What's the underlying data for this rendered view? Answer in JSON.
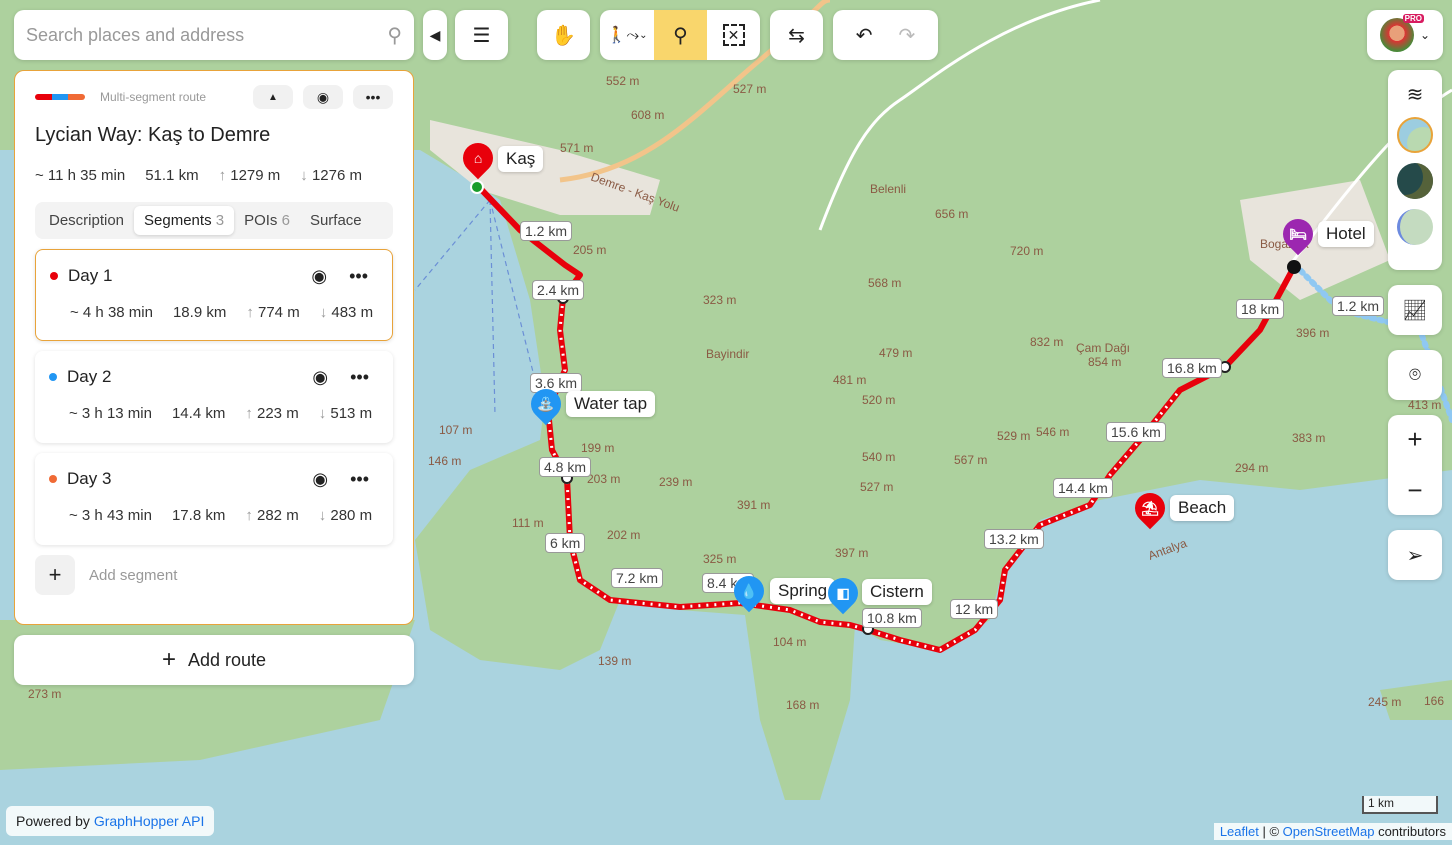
{
  "search": {
    "placeholder": "Search places and address"
  },
  "route": {
    "type_label": "Multi-segment route",
    "title": "Lycian Way: Kaş to Demre",
    "duration": "~ 11 h 35 min",
    "distance": "51.1 km",
    "ascent": "1279 m",
    "descent": "1276 m",
    "colors": [
      "#e8000b",
      "#2196f3",
      "#f06a35"
    ]
  },
  "tabs": [
    {
      "label": "Description",
      "count": ""
    },
    {
      "label": "Segments",
      "count": "3"
    },
    {
      "label": "POIs",
      "count": "6"
    },
    {
      "label": "Surface",
      "count": ""
    }
  ],
  "segments": [
    {
      "name": "Day 1",
      "color": "#e8000b",
      "duration": "~ 4 h 38 min",
      "distance": "18.9 km",
      "ascent": "774 m",
      "descent": "483 m"
    },
    {
      "name": "Day 2",
      "color": "#2196f3",
      "duration": "~ 3 h 13 min",
      "distance": "14.4 km",
      "ascent": "223 m",
      "descent": "513 m"
    },
    {
      "name": "Day 3",
      "color": "#f06a35",
      "duration": "~ 3 h 43 min",
      "distance": "17.8 km",
      "ascent": "282 m",
      "descent": "280 m"
    }
  ],
  "add_segment": "Add segment",
  "add_route": "Add route",
  "profile": {
    "badge": "PRO"
  },
  "pois": [
    "Kaş",
    "Water tap",
    "Spring",
    "Cistern",
    "Beach",
    "Hotel"
  ],
  "distance_markers": [
    "1.2 km",
    "2.4 km",
    "3.6 km",
    "4.8 km",
    "6 km",
    "7.2 km",
    "8.4 km",
    "10.8 km",
    "12 km",
    "13.2 km",
    "14.4 km",
    "15.6 km",
    "16.8 km",
    "18 km",
    "1.2 km"
  ],
  "place_labels": [
    "Belenli",
    "Bayindir",
    "Çam Dağı",
    "854 m",
    "Demre - Kaş Yolu",
    "Antalya",
    "Bogazcik"
  ],
  "elevations": [
    "552 m",
    "527 m",
    "608 m",
    "571 m",
    "205 m",
    "323 m",
    "568 m",
    "656 m",
    "720 m",
    "832 m",
    "479 m",
    "481 m",
    "520 m",
    "546 m",
    "529 m",
    "540 m",
    "527 m",
    "567 m",
    "391 m",
    "397 m",
    "325 m",
    "199 m",
    "203 m",
    "239 m",
    "202 m",
    "107 m",
    "146 m",
    "111 m",
    "104 m",
    "168 m",
    "139 m",
    "273 m",
    "396 m",
    "413 m",
    "383 m",
    "294 m",
    "245 m",
    "166"
  ],
  "footer": {
    "powered": "Powered by ",
    "powered_link": "GraphHopper API",
    "scale": "1 km",
    "leaflet": "Leaflet",
    "sep": " | © ",
    "osm": "OpenStreetMap",
    "contrib": " contributors"
  }
}
